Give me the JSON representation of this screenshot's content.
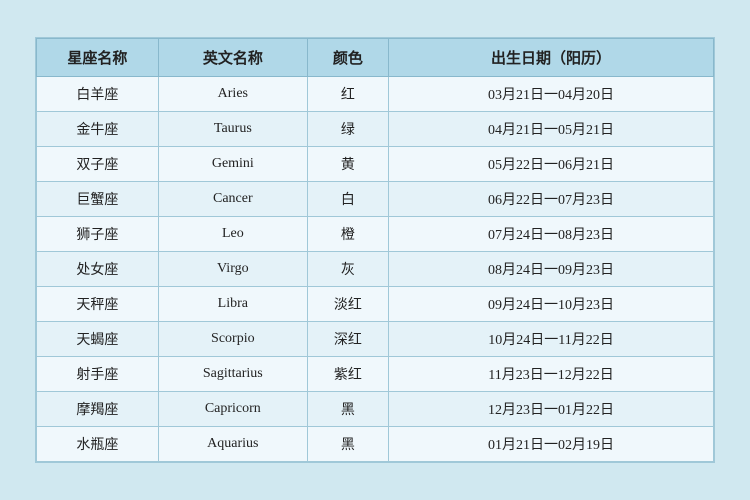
{
  "table": {
    "headers": [
      "星座名称",
      "英文名称",
      "颜色",
      "出生日期（阳历）"
    ],
    "rows": [
      {
        "zh": "白羊座",
        "en": "Aries",
        "color": "红",
        "date": "03月21日一04月20日"
      },
      {
        "zh": "金牛座",
        "en": "Taurus",
        "color": "绿",
        "date": "04月21日一05月21日"
      },
      {
        "zh": "双子座",
        "en": "Gemini",
        "color": "黄",
        "date": "05月22日一06月21日"
      },
      {
        "zh": "巨蟹座",
        "en": "Cancer",
        "color": "白",
        "date": "06月22日一07月23日"
      },
      {
        "zh": "狮子座",
        "en": "Leo",
        "color": "橙",
        "date": "07月24日一08月23日"
      },
      {
        "zh": "处女座",
        "en": "Virgo",
        "color": "灰",
        "date": "08月24日一09月23日"
      },
      {
        "zh": "天秤座",
        "en": "Libra",
        "color": "淡红",
        "date": "09月24日一10月23日"
      },
      {
        "zh": "天蝎座",
        "en": "Scorpio",
        "color": "深红",
        "date": "10月24日一11月22日"
      },
      {
        "zh": "射手座",
        "en": "Sagittarius",
        "color": "紫红",
        "date": "11月23日一12月22日"
      },
      {
        "zh": "摩羯座",
        "en": "Capricorn",
        "color": "黑",
        "date": "12月23日一01月22日"
      },
      {
        "zh": "水瓶座",
        "en": "Aquarius",
        "color": "黑",
        "date": "01月21日一02月19日"
      }
    ]
  }
}
